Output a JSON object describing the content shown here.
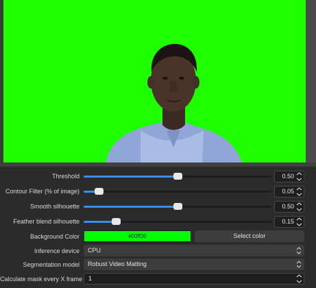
{
  "preview": {
    "background_color": "#1eff00"
  },
  "properties": {
    "threshold": {
      "label": "Threshold",
      "value": "0.50",
      "fraction": 0.5
    },
    "contour_filter": {
      "label": "Contour Filter (% of image)",
      "value": "0.05",
      "fraction": 0.08
    },
    "smooth_silhouette": {
      "label": "Smooth silhouette",
      "value": "0.50",
      "fraction": 0.5
    },
    "feather_blend": {
      "label": "Feather blend silhouette",
      "value": "0.15",
      "fraction": 0.17
    },
    "background_color": {
      "label": "Background Color",
      "value": "#00ff00",
      "swatch_color": "#00ff00",
      "select_button": "Select color"
    },
    "inference_device": {
      "label": "Inference device",
      "value": "CPU"
    },
    "segmentation_model": {
      "label": "Segmentation model",
      "value": "Robust Video Matting"
    },
    "mask_every_x": {
      "label": "Calculate mask every X frame",
      "value": "1"
    }
  },
  "colors": {
    "accent": "#3b8ee8",
    "panel": "#2b2b2b"
  }
}
